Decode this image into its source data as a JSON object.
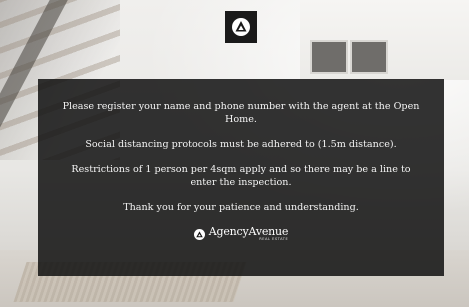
{
  "notice": {
    "paragraphs": [
      "Please register your name and phone number with the agent at the Open Home.",
      "Social distancing protocols must be adhered to (1.5m distance).",
      "Restrictions of 1 person per 4sqm apply and so there may be a line to enter the inspection.",
      "Thank you for your patience and understanding."
    ]
  },
  "brand": {
    "name": "AgencyAvenue",
    "subtitle": "REAL ESTATE",
    "logo_icon": "agency-avenue-logo-icon"
  },
  "colors": {
    "panel": "#121212",
    "text": "#ffffff",
    "badge": "#1a1a1a"
  }
}
